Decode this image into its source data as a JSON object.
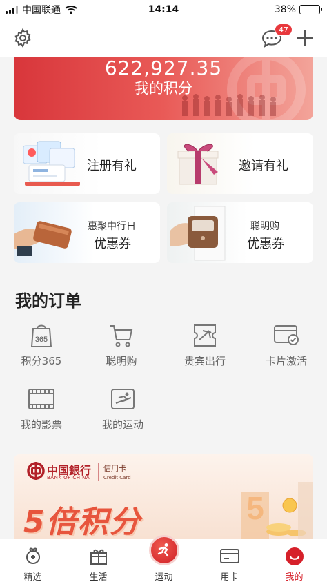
{
  "status_bar": {
    "carrier": "中国联通",
    "time": "14:14",
    "battery": "38%",
    "battery_level": 0.38
  },
  "header": {
    "message_count": "47"
  },
  "points": {
    "value": "622,927.35",
    "label": "我的积分"
  },
  "promos": [
    {
      "title": "注册有礼"
    },
    {
      "title": "邀请有礼"
    },
    {
      "sub": "惠聚中行日",
      "title": "优惠券"
    },
    {
      "sub": "聪明购",
      "title": "优惠券"
    }
  ],
  "orders": {
    "title": "我的订单",
    "items": [
      {
        "label": "积分365",
        "icon": "bag-365-icon",
        "icon_text": "365"
      },
      {
        "label": "聪明购",
        "icon": "shopping-cart-icon"
      },
      {
        "label": "贵宾出行",
        "icon": "plane-ticket-icon"
      },
      {
        "label": "卡片激活",
        "icon": "card-check-icon"
      },
      {
        "label": "我的影票",
        "icon": "film-ticket-icon"
      },
      {
        "label": "我的运动",
        "icon": "ski-icon"
      }
    ]
  },
  "ad": {
    "bank_cn": "中国銀行",
    "bank_en": "BANK OF CHINA",
    "card_cn": "信用卡",
    "card_en": "Credit Card",
    "headline": "5倍积分"
  },
  "tabbar": {
    "items": [
      {
        "label": "精选",
        "icon": "featured-icon"
      },
      {
        "label": "生活",
        "icon": "gift-icon"
      },
      {
        "label": "运动",
        "icon": "runner-icon"
      },
      {
        "label": "用卡",
        "icon": "card-icon"
      },
      {
        "label": "我的",
        "icon": "profile-icon"
      }
    ],
    "active_index": 4
  },
  "colors": {
    "brand_red": "#d6202a",
    "badge_red": "#e8383d",
    "battery_green": "#35c659"
  }
}
